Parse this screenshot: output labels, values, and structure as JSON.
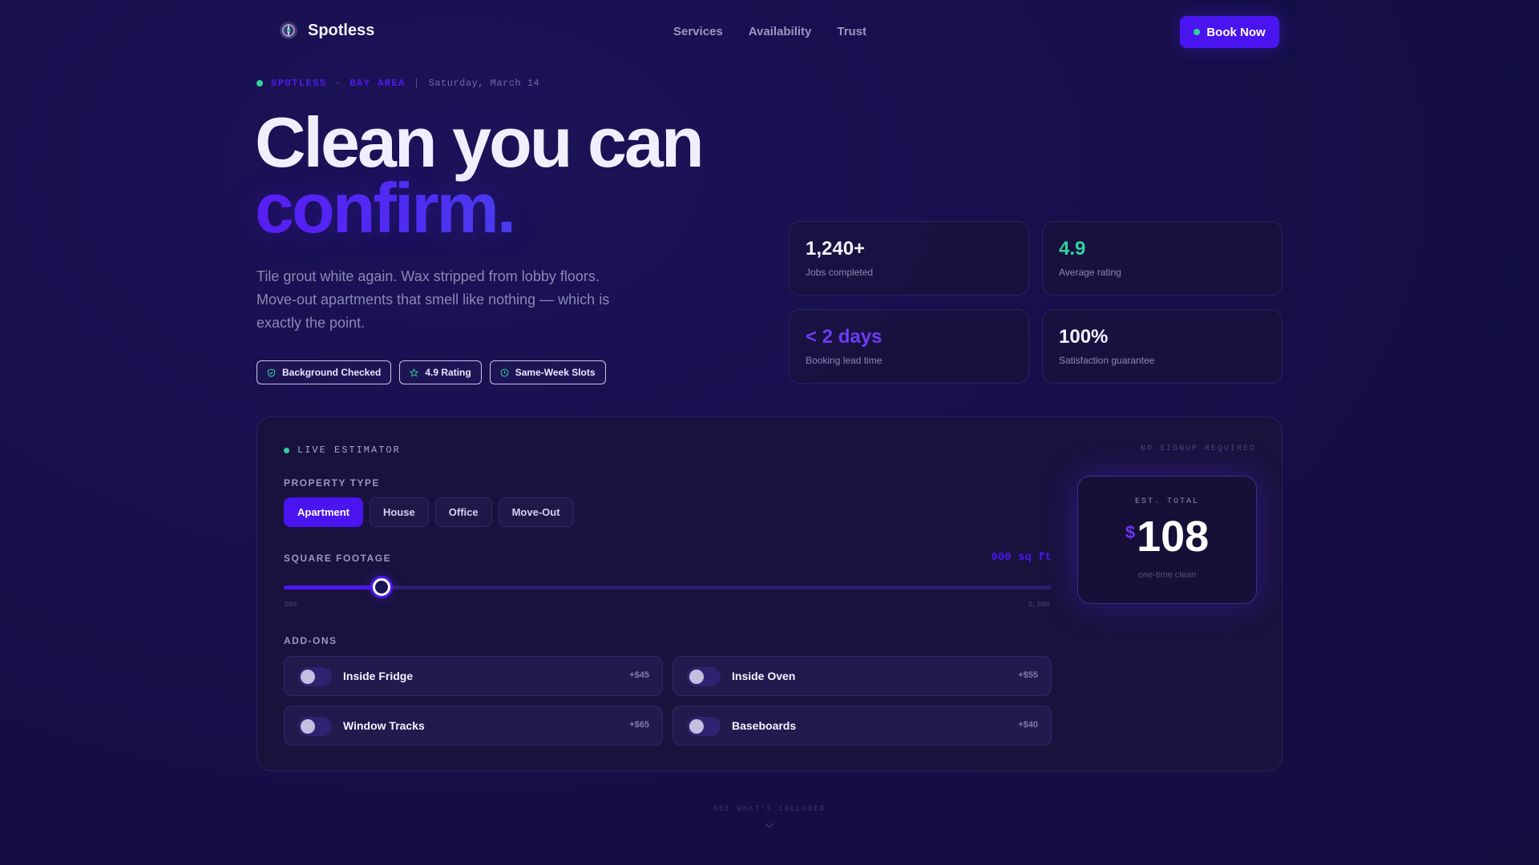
{
  "brand": {
    "name": "Spotless"
  },
  "nav": {
    "links": [
      "Services",
      "Availability",
      "Trust"
    ],
    "cta": "Book Now"
  },
  "eyebrow": {
    "brand": "SPOTLESS",
    "dot": "·",
    "region": "BAY AREA",
    "sep": "|",
    "date": "Saturday, March 14"
  },
  "hero": {
    "title_line1": "Clean you can",
    "title_line2": "confirm.",
    "lede": "Tile grout white again. Wax stripped from lobby floors. Move-out apartments that smell like nothing — which is exactly the point.",
    "chips": [
      {
        "label": "Background Checked",
        "icon": "shield-check-icon"
      },
      {
        "label": "4.9 Rating",
        "icon": "star-icon"
      },
      {
        "label": "Same-Week Slots",
        "icon": "clock-icon"
      }
    ]
  },
  "stats": [
    {
      "value": "1,240+",
      "label": "Jobs completed"
    },
    {
      "value": "4.9",
      "label": "Average rating"
    },
    {
      "value": "< 2 days",
      "label": "Booking lead time"
    },
    {
      "value": "100%",
      "label": "Satisfaction guarantee"
    }
  ],
  "estimator": {
    "title": "LIVE ESTIMATOR",
    "badge": "NO SIGNUP REQUIRED",
    "property_type_label": "PROPERTY TYPE",
    "property_types": [
      "Apartment",
      "House",
      "Office",
      "Move-Out"
    ],
    "selected_property_type": "Apartment",
    "square_footage_label": "SQUARE FOOTAGE",
    "square_footage_display": "900 sq ft",
    "slider": {
      "min": 300,
      "max": 5000,
      "value": 900,
      "min_label": "300",
      "max_label": "5,000"
    },
    "addons_label": "ADD-ONS",
    "addons": [
      {
        "name": "Inside Fridge",
        "price": "+$45",
        "enabled": false
      },
      {
        "name": "Inside Oven",
        "price": "+$55",
        "enabled": false
      },
      {
        "name": "Window Tracks",
        "price": "+$65",
        "enabled": false
      },
      {
        "name": "Baseboards",
        "price": "+$40",
        "enabled": false
      }
    ],
    "total": {
      "label": "EST. TOTAL",
      "currency": "$",
      "amount": "108",
      "sub": "one-time clean"
    }
  },
  "scroll_cue": "SEE WHAT'S INCLUDED",
  "colors": {
    "accent": "#4a14f0",
    "green": "#2fd39a",
    "background": "#160f4a"
  }
}
